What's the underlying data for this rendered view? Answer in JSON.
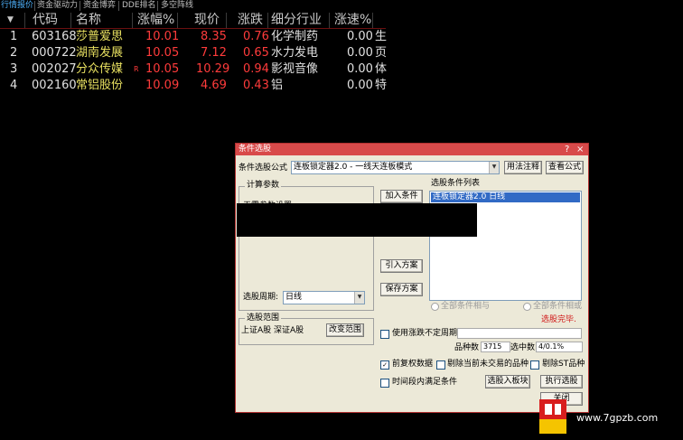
{
  "tabs": [
    "行情报价",
    "资金驱动力",
    "资金博弈",
    "DDE排名",
    "多空阵线"
  ],
  "sort_indicator": "▼",
  "columns": [
    "代码",
    "名称",
    "涨幅%",
    "现价",
    "涨跌",
    "细分行业",
    "涨速%"
  ],
  "rows": [
    {
      "idx": "1",
      "code": "603168",
      "name": "莎普爱思",
      "pct": "10.01",
      "price": "8.35",
      "chg": "0.76",
      "industry": "化学制药",
      "speed": "0.00",
      "extra": "生"
    },
    {
      "idx": "2",
      "code": "000722",
      "name": "湖南发展",
      "pct": "10.05",
      "price": "7.12",
      "chg": "0.65",
      "industry": "水力发电",
      "speed": "0.00",
      "extra": "页"
    },
    {
      "idx": "3",
      "code": "002027",
      "name": "分众传媒",
      "pct": "10.05",
      "price": "10.29",
      "chg": "0.94",
      "industry": "影视音像",
      "speed": "0.00",
      "extra": "体"
    },
    {
      "idx": "4",
      "code": "002160",
      "name": "常铝股份",
      "pct": "10.09",
      "price": "4.69",
      "chg": "0.43",
      "industry": "铝",
      "speed": "0.00",
      "extra": "特"
    }
  ],
  "row3_marker": "R",
  "dialog": {
    "title": "条件选股",
    "help_btn": "?",
    "close_btn": "×",
    "formula_label": "条件选股公式",
    "formula_value": "连板锁定器2.0 - 一线天连板模式",
    "usage_btn": "用法注释",
    "view_btn": "查看公式",
    "calc_group": "计算参数",
    "calc_text": "无需参数设置",
    "add_cond_btn": "加入条件",
    "cond_list_label": "选股条件列表",
    "cond_item": "连板锁定器2.0  日线",
    "import_btn": "引入方案",
    "save_btn": "保存方案",
    "period_label": "选股周期:",
    "period_value": "日线",
    "radio_and": "全部条件相与",
    "radio_or": "全部条件相或",
    "status": "选股完毕.",
    "range_group": "选股范围",
    "range_text": "上证A股  深证A股",
    "change_range_btn": "改变范围",
    "uncertain_period": "使用涨跌不定周期",
    "count_label": "品种数",
    "count_value": "3715",
    "selected_label": "选中数",
    "selected_value": "4/0.1%",
    "pre_rights": "前复权数据",
    "exclude_suspended": "剔除当前未交易的品种",
    "exclude_st": "剔除ST品种",
    "time_range": "时间段内满足条件",
    "into_block_btn": "选股入板块",
    "execute_btn": "执行选股",
    "close_dialog_btn": "关闭"
  },
  "watermark": "www.7gpzb.com"
}
